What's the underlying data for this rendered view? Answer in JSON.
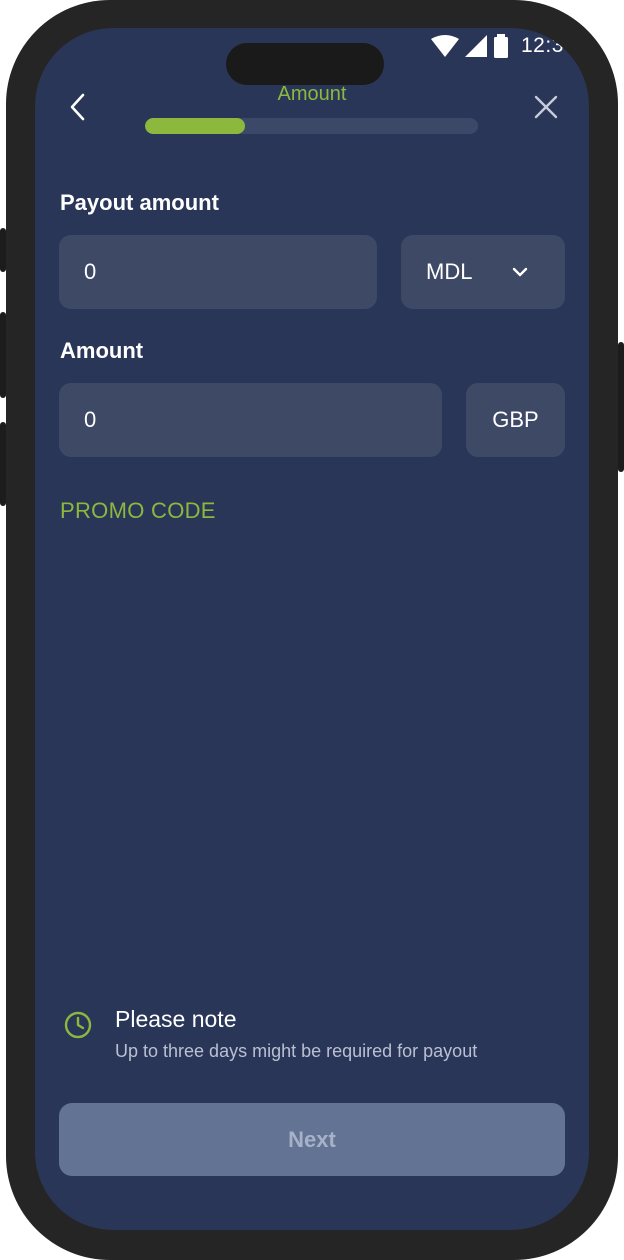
{
  "status_bar": {
    "time": "12:3",
    "wifi_icon": "wifi-icon",
    "signal_icon": "signal-icon",
    "battery_icon": "battery-icon"
  },
  "header": {
    "back_icon": "chevron-left-icon",
    "close_icon": "close-icon",
    "step_title": "Amount",
    "progress": 0.3
  },
  "form": {
    "payout_label": "Payout amount",
    "payout_value": "0",
    "payout_currency": "MDL",
    "payout_currency_icon": "chevron-down-icon",
    "amount_label": "Amount",
    "amount_value": "0",
    "amount_currency": "GBP",
    "promo_label": "PROMO CODE"
  },
  "note": {
    "icon": "clock-icon",
    "title": "Please note",
    "text": "Up to three days might be required for payout"
  },
  "footer": {
    "next_label": "Next"
  },
  "colors": {
    "background": "#2a3658",
    "accent": "#8bb83d",
    "field": "#3e4966",
    "button": "#627393"
  }
}
